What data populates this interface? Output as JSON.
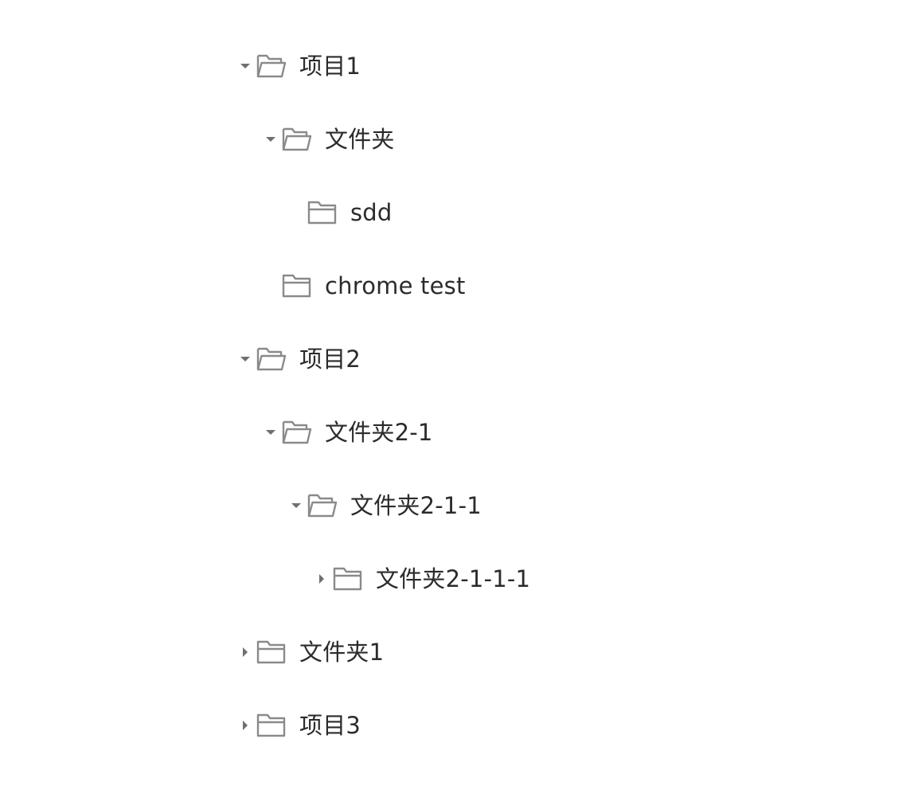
{
  "tree": {
    "nodes": [
      {
        "label": "项目1",
        "depth": 0,
        "toggle": "expanded",
        "folder": "open"
      },
      {
        "label": "文件夹",
        "depth": 1,
        "toggle": "expanded",
        "folder": "open"
      },
      {
        "label": "sdd",
        "depth": 2,
        "toggle": "none",
        "folder": "closed"
      },
      {
        "label": "chrome test",
        "depth": 1,
        "toggle": "none",
        "folder": "closed"
      },
      {
        "label": "项目2",
        "depth": 0,
        "toggle": "expanded",
        "folder": "open"
      },
      {
        "label": "文件夹2-1",
        "depth": 1,
        "toggle": "expanded",
        "folder": "open"
      },
      {
        "label": "文件夹2-1-1",
        "depth": 2,
        "toggle": "expanded",
        "folder": "open"
      },
      {
        "label": "文件夹2-1-1-1",
        "depth": 3,
        "toggle": "collapsed",
        "folder": "closed"
      },
      {
        "label": "文件夹1",
        "depth": 0,
        "toggle": "collapsed",
        "folder": "closed"
      },
      {
        "label": "项目3",
        "depth": 0,
        "toggle": "collapsed",
        "folder": "closed"
      }
    ]
  },
  "colors": {
    "icon": "#8a8a8a",
    "text": "#2b2b2b",
    "background": "#ffffff"
  }
}
